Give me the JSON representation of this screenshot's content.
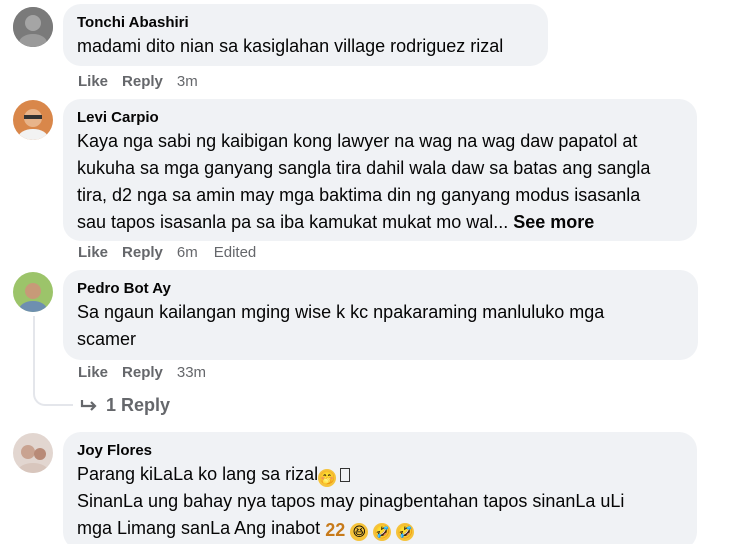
{
  "comments": [
    {
      "author": "Tonchi Abashiri",
      "text": "madami dito nian sa kasiglahan village rodriguez rizal",
      "actions": {
        "like": "Like",
        "reply": "Reply",
        "time": "3m"
      }
    },
    {
      "author": "Levi Carpio",
      "text_lines": [
        "Kaya nga sabi ng kaibigan kong lawyer na wag na wag daw papatol at",
        "kukuha sa mga ganyang sangla tira dahil wala daw sa batas ang sangla",
        "tira, d2 nga sa amin may mga baktima din ng ganyang modus isasanla",
        "sau tapos isasanla pa sa iba kamukat mukat mo wal..."
      ],
      "see_more": "See more",
      "actions": {
        "like": "Like",
        "reply": "Reply",
        "time": "6m",
        "edited": "Edited"
      }
    },
    {
      "author": "Pedro Bot Ay",
      "text_lines": [
        "Sa ngaun kailangan mging wise k kc npakaraming manluluko mga",
        "scamer"
      ],
      "actions": {
        "like": "Like",
        "reply": "Reply",
        "time": "33m"
      },
      "replies": {
        "arrow_icon": "reply-arrow-icon",
        "label": "1 Reply"
      }
    },
    {
      "author": "Joy Flores",
      "line1": "Parang kiLaLa ko lang sa rizal",
      "line2": "SinanLa ung bahay nya tapos may pinagbentahan tapos sinanLa uLi",
      "line3": "mga Limang sanLa Ang inabot"
    }
  ],
  "colors": {
    "bubble": "#f0f2f5",
    "meta": "#65676b",
    "text": "#050505"
  }
}
